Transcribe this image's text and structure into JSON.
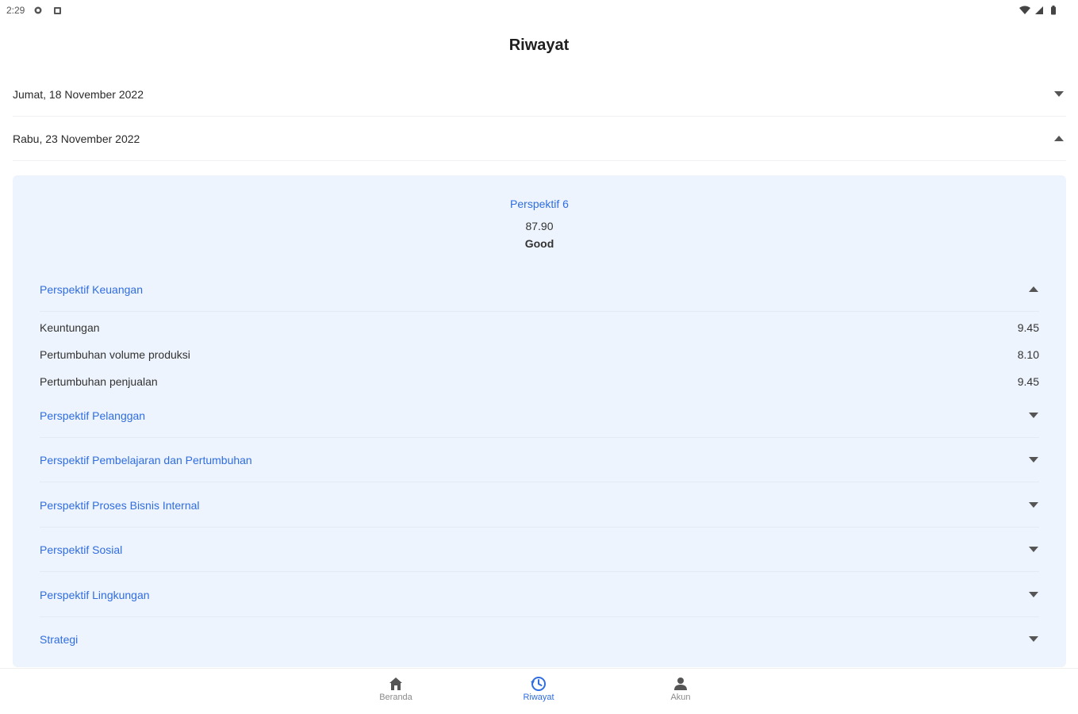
{
  "status": {
    "time": "2:29"
  },
  "header": {
    "title": "Riwayat"
  },
  "dates": [
    {
      "label": "Jumat, 18 November 2022",
      "expanded": false
    },
    {
      "label": "Rabu, 23 November 2022",
      "expanded": true
    }
  ],
  "summary": {
    "title": "Perspektif 6",
    "value": "87.90",
    "grade": "Good"
  },
  "sections": [
    {
      "label": "Perspektif Keuangan",
      "expanded": true
    },
    {
      "label": "Perspektif Pelanggan",
      "expanded": false
    },
    {
      "label": "Perspektif Pembelajaran dan Pertumbuhan",
      "expanded": false
    },
    {
      "label": "Perspektif Proses Bisnis Internal",
      "expanded": false
    },
    {
      "label": "Perspektif Sosial",
      "expanded": false
    },
    {
      "label": "Perspektif Lingkungan",
      "expanded": false
    },
    {
      "label": "Strategi",
      "expanded": false
    }
  ],
  "metrics": [
    {
      "label": "Keuntungan",
      "value": "9.45"
    },
    {
      "label": "Pertumbuhan volume produksi",
      "value": "8.10"
    },
    {
      "label": "Pertumbuhan penjualan",
      "value": "9.45"
    }
  ],
  "nav": [
    {
      "label": "Beranda",
      "icon": "home-icon",
      "active": false
    },
    {
      "label": "Riwayat",
      "icon": "history-icon",
      "active": true
    },
    {
      "label": "Akun",
      "icon": "person-icon",
      "active": false
    }
  ],
  "colors": {
    "accent": "#2f6de0",
    "panel": "#eef4fd"
  }
}
